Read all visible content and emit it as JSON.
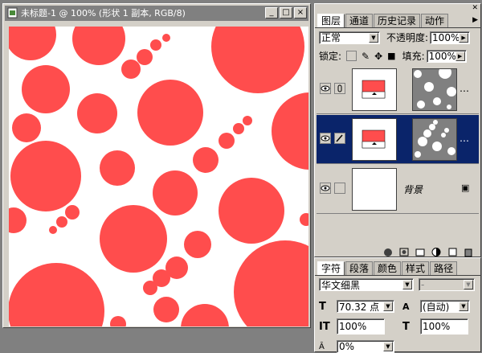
{
  "document_window": {
    "title": "未标题-1 @ 100% (形状 1 副本, RGB/8)",
    "buttons": {
      "minimize": "_",
      "maximize": "□",
      "close": "×"
    }
  },
  "canvas": {
    "background": "#ffffff",
    "shape_color": "#ff4d4d"
  },
  "layers_panel": {
    "tabs": [
      "图层",
      "通道",
      "历史记录",
      "动作"
    ],
    "active_tab": "图层",
    "blend_mode": "正常",
    "opacity_label": "不透明度:",
    "opacity_value": "100%",
    "lock_label": "锁定:",
    "fill_label": "填充:",
    "fill_value": "100%",
    "layers": [
      {
        "name": "",
        "selected": false,
        "visible": true,
        "has_mask": true
      },
      {
        "name": "",
        "selected": true,
        "visible": true,
        "has_mask": true
      },
      {
        "name": "背景",
        "selected": false,
        "visible": true,
        "locked": true
      }
    ],
    "more_dots": "…",
    "selection_color": "#0a246a"
  },
  "character_panel": {
    "tabs": [
      "字符",
      "段落",
      "颜色",
      "样式",
      "路径"
    ],
    "active_tab": "字符",
    "font_family": "华文细黑",
    "font_style": "-",
    "font_size": "70.32 点",
    "leading": "(自动)",
    "vertical_scale": "100%",
    "horizontal_scale": "100%",
    "tracking": "0%"
  }
}
